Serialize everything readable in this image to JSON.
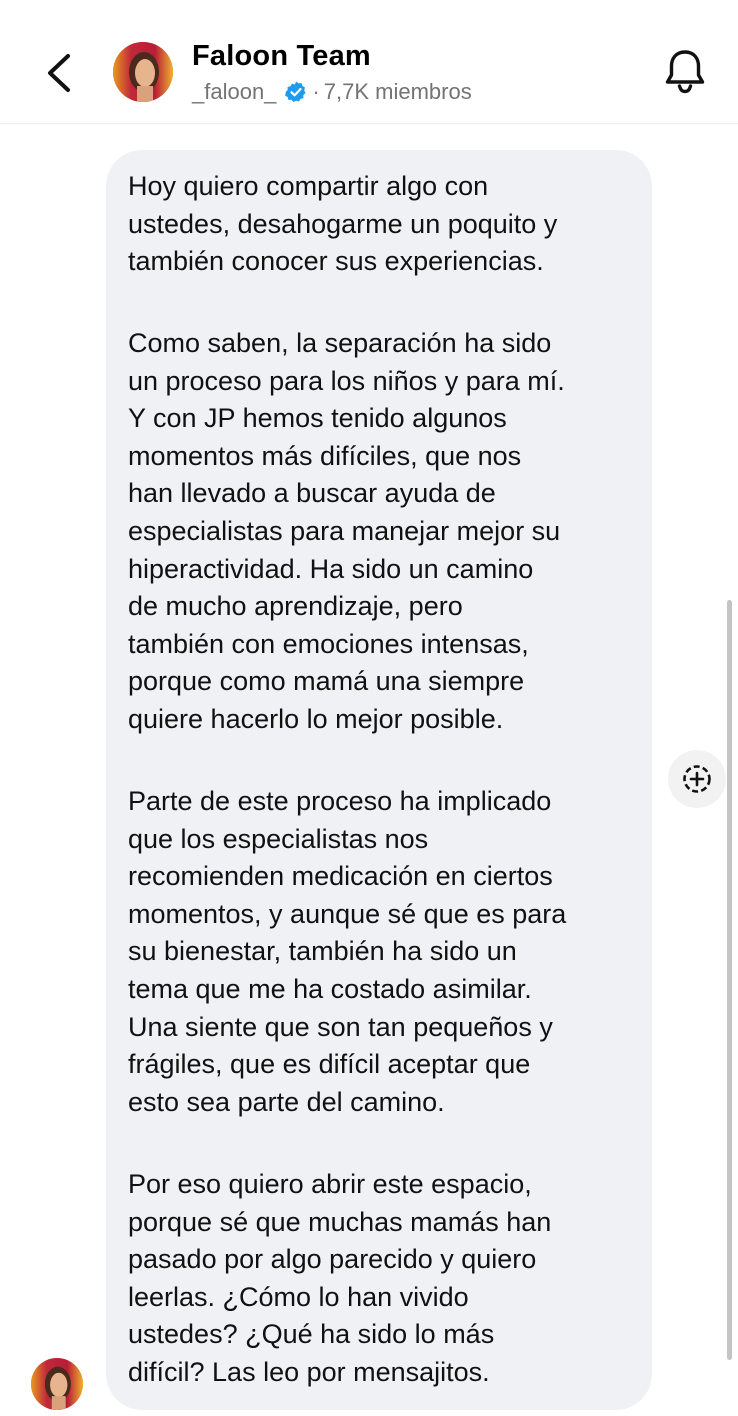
{
  "header": {
    "title": "Faloon Team",
    "handle": "_faloon_",
    "separator": "·",
    "members": "7,7K miembros",
    "icons": {
      "back": "chevron-left-icon",
      "verified": "verified-badge-icon",
      "bell": "bell-icon"
    }
  },
  "message": {
    "paragraphs": [
      "Hoy quiero compartir algo con\nustedes, desahogarme un poquito y\ntambién conocer sus experiencias.",
      "Como saben, la separación ha sido\nun proceso para los niños y para mí.\nY con JP hemos tenido algunos\nmomentos más difíciles, que nos\nhan llevado a buscar ayuda de\nespecialistas para manejar mejor su\nhiperactividad. Ha sido un camino\nde mucho aprendizaje, pero\ntambién con emociones intensas,\nporque como mamá una siempre\nquiere hacerlo lo mejor posible.",
      "Parte de este proceso ha implicado\nque los especialistas nos\nrecomienden medicación en ciertos\nmomentos, y aunque sé que es para\nsu bienestar, también ha sido un\ntema que me ha costado asimilar.\nUna siente que son tan pequeños y\nfrágiles, que es difícil aceptar que\nesto sea parte del camino.",
      "Por eso quiero abrir este espacio,\nporque sé que muchas mamás han\npasado por algo parecido y quiero\nleerlas. ¿Cómo lo han vivido\nustedes? ¿Qué ha sido lo más\ndifícil? Las leo por mensajitos."
    ]
  },
  "icons": {
    "react": "add-reaction-icon"
  },
  "colors": {
    "bubble": "#f0f1f4",
    "verified": "#1d9bf0",
    "subtitle": "#737373"
  }
}
